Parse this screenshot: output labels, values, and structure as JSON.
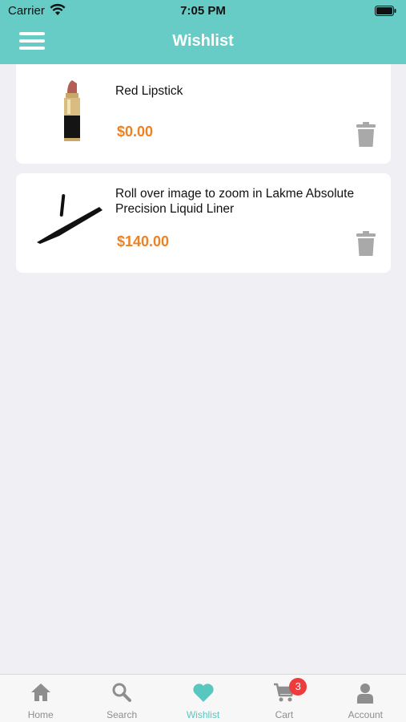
{
  "status_bar": {
    "carrier": "Carrier",
    "time": "7:05 PM"
  },
  "nav": {
    "title": "Wishlist"
  },
  "wishlist": {
    "items": [
      {
        "title": "Red Lipstick",
        "price": "$0.00",
        "image": "lipstick-image"
      },
      {
        "title": " Roll over image to zoom in Lakme Absolute Precision Liquid Liner",
        "price": "$140.00",
        "image": "eyeliner-image"
      }
    ]
  },
  "tabs": [
    {
      "label": "Home",
      "icon": "home-icon",
      "active": false
    },
    {
      "label": "Search",
      "icon": "search-icon",
      "active": false
    },
    {
      "label": "Wishlist",
      "icon": "heart-icon",
      "active": true
    },
    {
      "label": "Cart",
      "icon": "cart-icon",
      "active": false,
      "badge": "3"
    },
    {
      "label": "Account",
      "icon": "person-icon",
      "active": false
    }
  ],
  "colors": {
    "accent": "#67cbc6",
    "price": "#ef8122",
    "badge": "#ee3b3b",
    "tab_active": "#57c7c0"
  }
}
